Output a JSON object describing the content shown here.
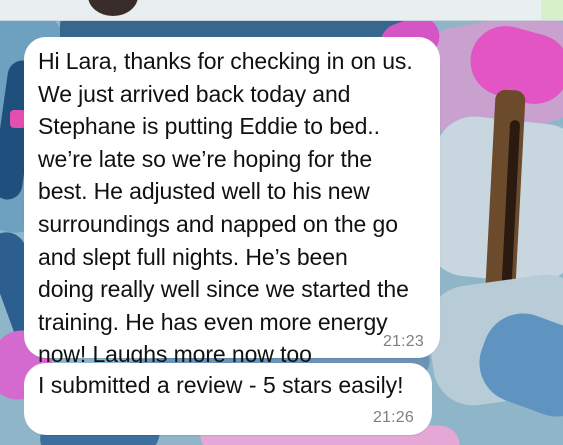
{
  "conversation": {
    "messages": [
      {
        "text": "Hi Lara, thanks for checking in on us.\nWe just arrived back today and\nStephane is putting Eddie to bed..\nwe’re late so we’re hoping for the\nbest. He adjusted well to his new\nsurroundings and napped on the go\nand slept full nights. He’s been\ndoing really well since we started the\ntraining. He has even more energy\nnow! Laughs more now too",
        "time": "21:23"
      },
      {
        "text": "I submitted a review - 5 stars easily!",
        "time": "21:26"
      }
    ]
  },
  "colors": {
    "bubble_background": "#ffffff",
    "timestamp_text": "#7b7f82",
    "wallpaper_accent_pink": "#e354c4",
    "wallpaper_accent_blue": "#2c5f8f"
  },
  "icons": {
    "contact_avatar": "avatar"
  }
}
